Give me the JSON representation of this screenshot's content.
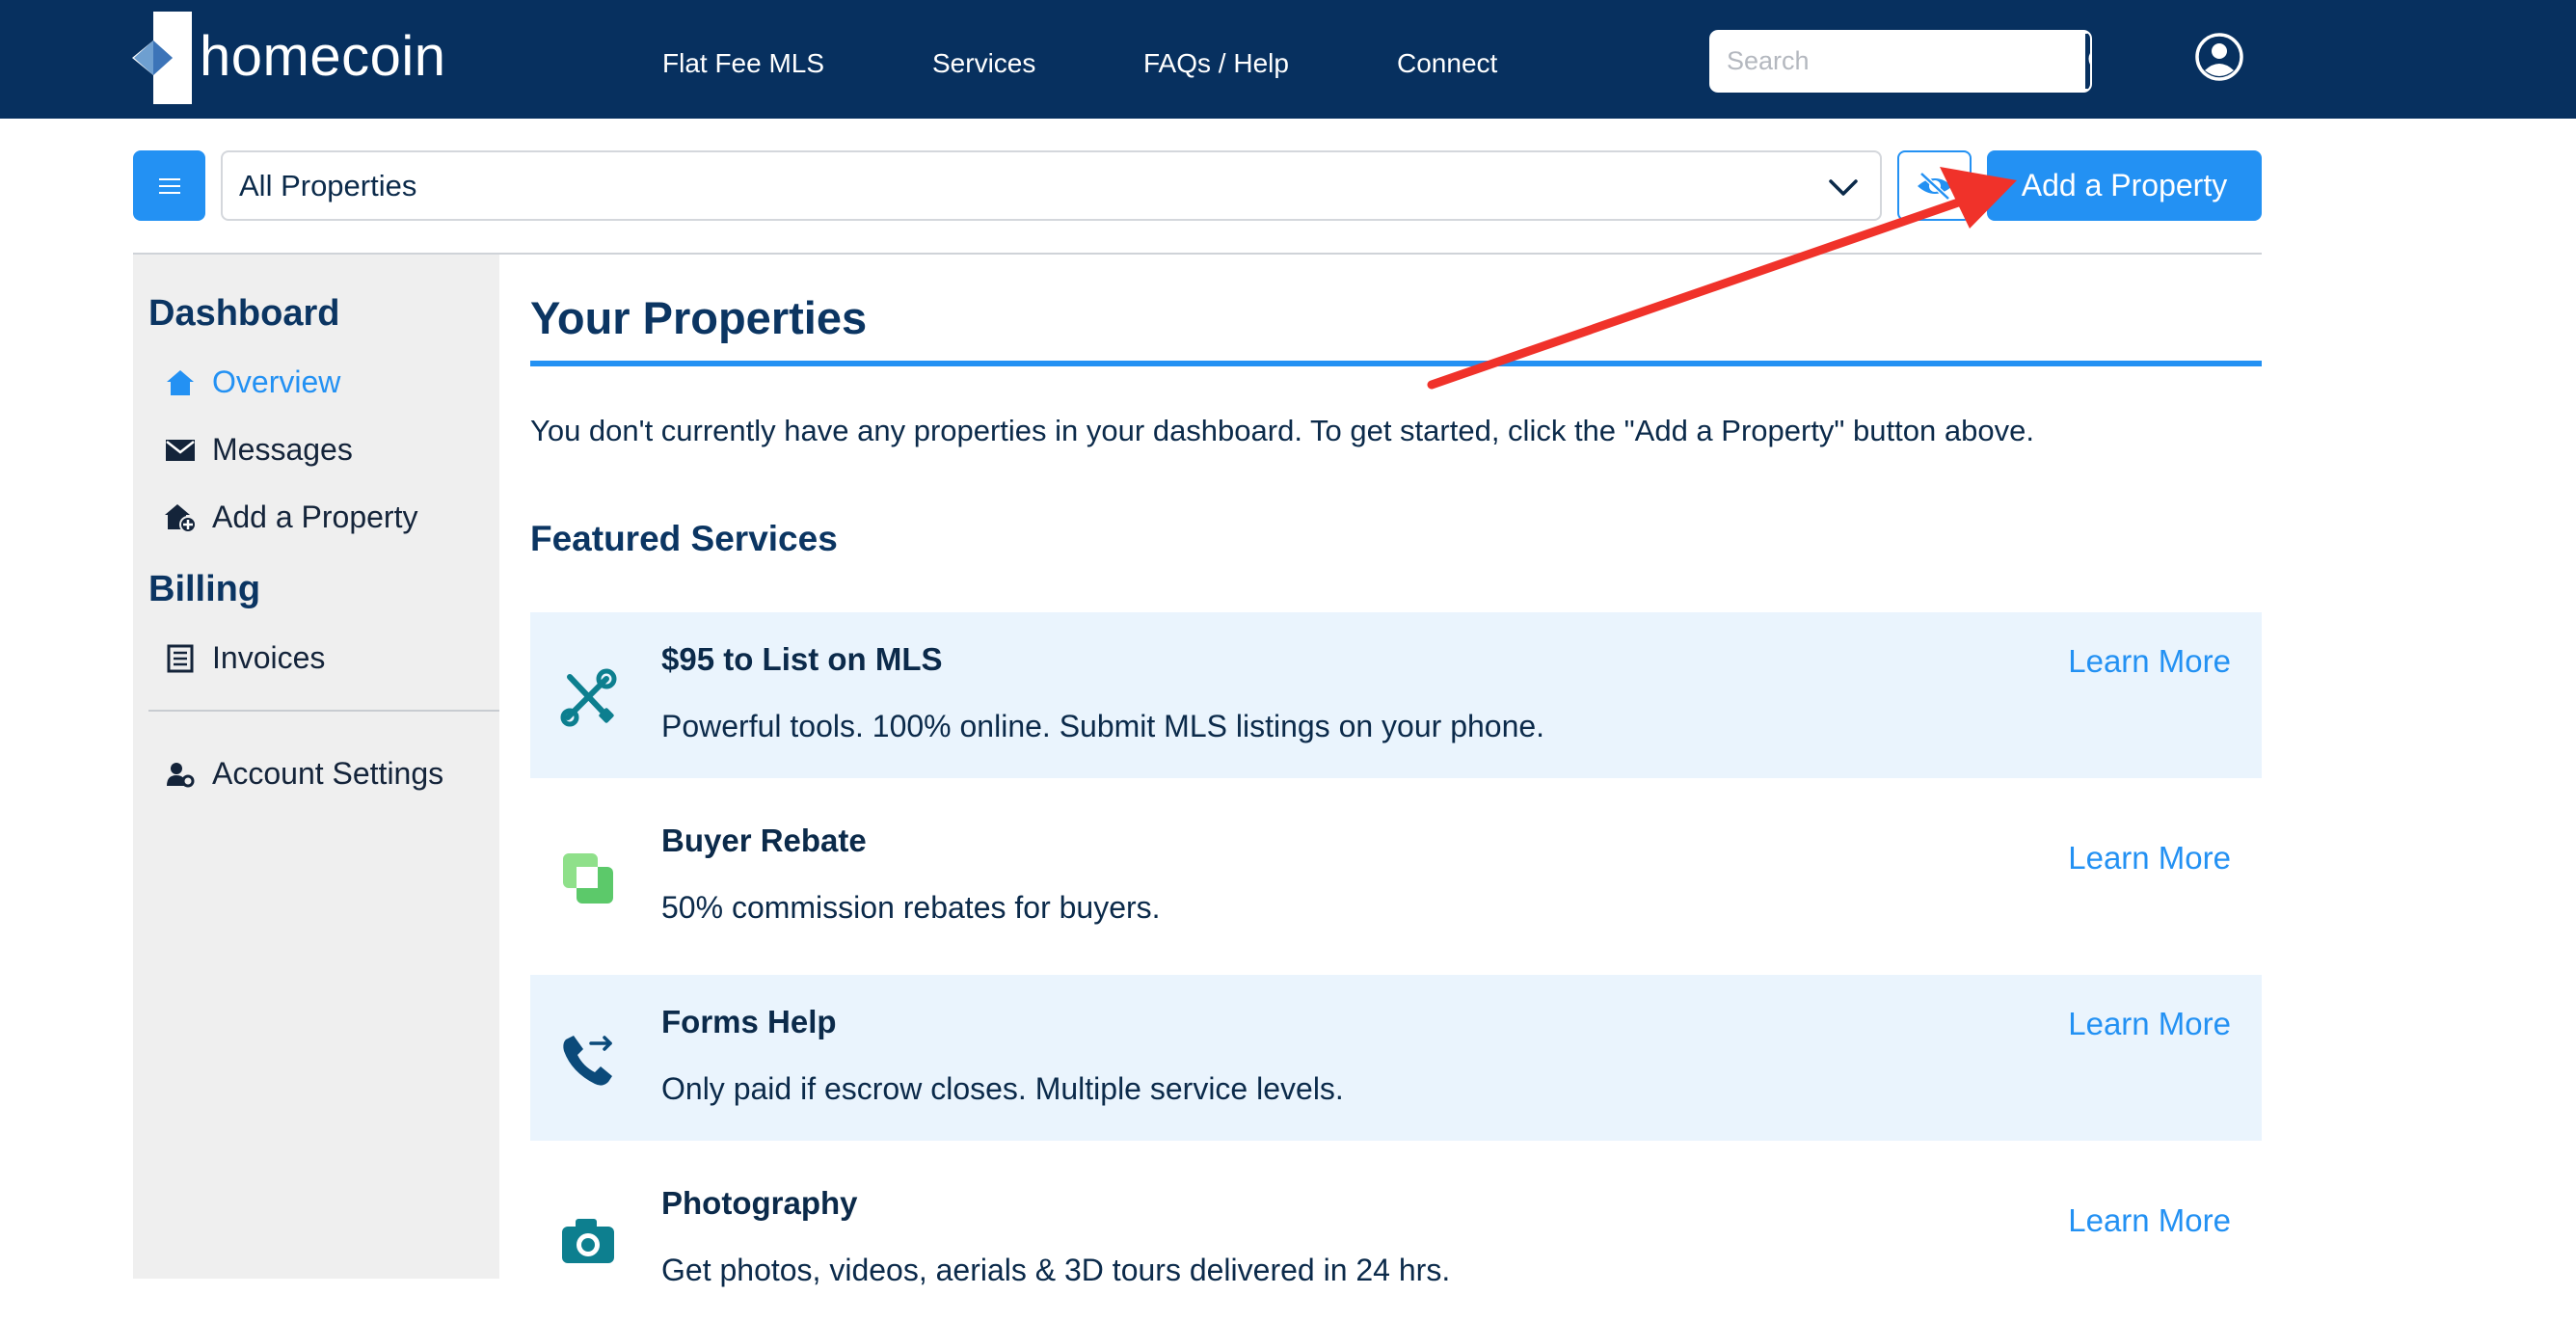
{
  "brand": {
    "name": "homecoin"
  },
  "nav": {
    "links": [
      "Flat Fee MLS",
      "Services",
      "FAQs / Help",
      "Connect"
    ],
    "search_placeholder": "Search"
  },
  "toolbar": {
    "property_select": "All Properties",
    "add_button": "Add a Property"
  },
  "sidebar": {
    "dashboard_heading": "Dashboard",
    "items": [
      {
        "label": "Overview",
        "icon": "home-icon",
        "active": true
      },
      {
        "label": "Messages",
        "icon": "envelope-icon"
      },
      {
        "label": "Add a Property",
        "icon": "house-plus-icon"
      }
    ],
    "billing_heading": "Billing",
    "billing_items": [
      {
        "label": "Invoices",
        "icon": "invoice-icon"
      }
    ],
    "settings_item": {
      "label": "Account Settings",
      "icon": "user-gear-icon"
    }
  },
  "main": {
    "title": "Your Properties",
    "intro": "You don't currently have any properties in your dashboard. To get started, click the \"Add a Property\" button above.",
    "featured_title": "Featured Services",
    "services": [
      {
        "name": "$95 to List on MLS",
        "desc": "Powerful tools. 100% online. Submit MLS listings on your phone.",
        "link": "Learn More",
        "icon": "tools-icon"
      },
      {
        "name": "Buyer Rebate",
        "desc": "50% commission rebates for buyers.",
        "link": "Learn More",
        "icon": "rebate-icon"
      },
      {
        "name": "Forms Help",
        "desc": "Only paid if escrow closes. Multiple service levels.",
        "link": "Learn More",
        "icon": "phone-forward-icon"
      },
      {
        "name": "Photography",
        "desc": "Get photos, videos, aerials & 3D tours delivered in 24 hrs.",
        "link": "Learn More",
        "icon": "camera-icon"
      }
    ]
  },
  "colors": {
    "navy": "#07305f",
    "accent": "#2391f3",
    "shade": "#eaf4fd",
    "sidebar": "#efefef",
    "annotation": "#f0322a"
  }
}
